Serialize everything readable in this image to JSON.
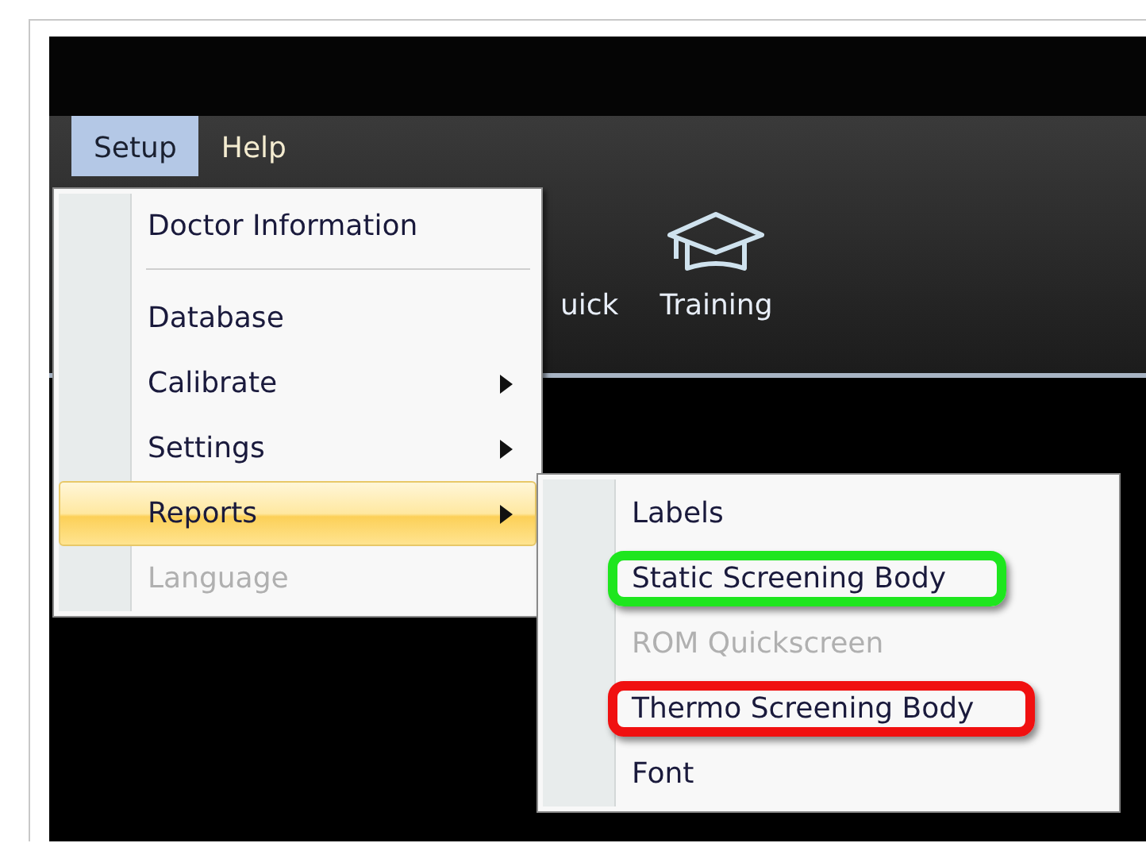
{
  "menubar": [
    {
      "label": "Setup",
      "selected": true
    },
    {
      "label": "Help",
      "selected": false
    }
  ],
  "toolbar": [
    {
      "label": "uick",
      "kind": "plain"
    },
    {
      "label": "Training",
      "kind": "mortarboard"
    }
  ],
  "menu": {
    "items": [
      {
        "kind": "item",
        "label": "Doctor Information",
        "submenu": false,
        "disabled": false,
        "selected": false
      },
      {
        "kind": "separator"
      },
      {
        "kind": "item",
        "label": "Database",
        "submenu": false,
        "disabled": false,
        "selected": false
      },
      {
        "kind": "item",
        "label": "Calibrate",
        "submenu": true,
        "disabled": false,
        "selected": false
      },
      {
        "kind": "item",
        "label": "Settings",
        "submenu": true,
        "disabled": false,
        "selected": false
      },
      {
        "kind": "item",
        "label": "Reports",
        "submenu": true,
        "disabled": false,
        "selected": true
      },
      {
        "kind": "item",
        "label": "Language",
        "submenu": false,
        "disabled": true,
        "selected": false
      }
    ]
  },
  "submenu": {
    "items": [
      {
        "label": "Labels",
        "disabled": false
      },
      {
        "label": "Static Screening Body",
        "disabled": false,
        "color": "#1ee61e"
      },
      {
        "label": "ROM Quickscreen",
        "disabled": true
      },
      {
        "label": "Thermo Screening Body",
        "disabled": false,
        "color": "#f01010"
      },
      {
        "label": "Font",
        "disabled": false
      }
    ]
  }
}
